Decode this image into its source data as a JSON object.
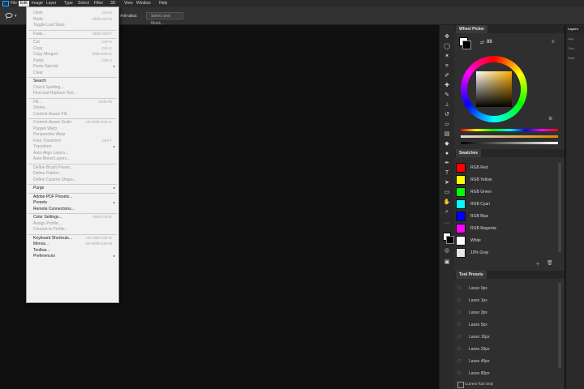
{
  "menubar": {
    "items": [
      "File",
      "Edit",
      "Image",
      "Layer",
      "Type",
      "Select",
      "Filter",
      "3D",
      "View",
      "Window",
      "Help"
    ],
    "active_index": 1
  },
  "options": {
    "anti_alias": "Anti-alias",
    "select_and_mask": "Select and Mask..."
  },
  "edit_menu": {
    "items": [
      {
        "label": "Undo",
        "shortcut": "Ctrl+Z",
        "enabled": false
      },
      {
        "label": "Redo",
        "shortcut": "Shift+Ctrl+Z",
        "enabled": false
      },
      {
        "label": "Toggle Last State",
        "shortcut": "",
        "enabled": false
      },
      {
        "sep": true
      },
      {
        "label": "Fade...",
        "shortcut": "Shift+Ctrl+F",
        "enabled": false
      },
      {
        "sep": true
      },
      {
        "label": "Cut",
        "shortcut": "Ctrl+X",
        "enabled": false
      },
      {
        "label": "Copy",
        "shortcut": "Ctrl+C",
        "enabled": false
      },
      {
        "label": "Copy Merged",
        "shortcut": "Shift+Ctrl+C",
        "enabled": false
      },
      {
        "label": "Paste",
        "shortcut": "Ctrl+V",
        "enabled": false
      },
      {
        "label": "Paste Special",
        "shortcut": "",
        "enabled": false,
        "submenu": true
      },
      {
        "label": "Clear",
        "shortcut": "",
        "enabled": false
      },
      {
        "sep": true
      },
      {
        "label": "Search",
        "shortcut": "",
        "enabled": true
      },
      {
        "label": "Check Spelling...",
        "shortcut": "",
        "enabled": false
      },
      {
        "label": "Find and Replace Text...",
        "shortcut": "",
        "enabled": false
      },
      {
        "sep": true
      },
      {
        "label": "Fill...",
        "shortcut": "Shift+F5",
        "enabled": false
      },
      {
        "label": "Stroke...",
        "shortcut": "",
        "enabled": false
      },
      {
        "label": "Content-Aware Fill...",
        "shortcut": "",
        "enabled": false
      },
      {
        "sep": true
      },
      {
        "label": "Content-Aware Scale",
        "shortcut": "Alt+Shift+Ctrl+C",
        "enabled": false
      },
      {
        "label": "Puppet Warp",
        "shortcut": "",
        "enabled": false
      },
      {
        "label": "Perspective Warp",
        "shortcut": "",
        "enabled": false
      },
      {
        "label": "Free Transform",
        "shortcut": "Ctrl+T",
        "enabled": false
      },
      {
        "label": "Transform",
        "shortcut": "",
        "enabled": false,
        "submenu": true
      },
      {
        "label": "Auto-Align Layers...",
        "shortcut": "",
        "enabled": false
      },
      {
        "label": "Auto-Blend Layers...",
        "shortcut": "",
        "enabled": false
      },
      {
        "sep": true
      },
      {
        "label": "Define Brush Preset...",
        "shortcut": "",
        "enabled": false
      },
      {
        "label": "Define Pattern...",
        "shortcut": "",
        "enabled": false
      },
      {
        "label": "Define Custom Shape...",
        "shortcut": "",
        "enabled": false
      },
      {
        "sep": true
      },
      {
        "label": "Purge",
        "shortcut": "",
        "enabled": true,
        "submenu": true
      },
      {
        "sep": true
      },
      {
        "label": "Adobe PDF Presets...",
        "shortcut": "",
        "enabled": true
      },
      {
        "label": "Presets",
        "shortcut": "",
        "enabled": true,
        "submenu": true
      },
      {
        "label": "Remote Connections...",
        "shortcut": "",
        "enabled": true
      },
      {
        "sep": true
      },
      {
        "label": "Color Settings...",
        "shortcut": "Shift+Ctrl+K",
        "enabled": true
      },
      {
        "label": "Assign Profile...",
        "shortcut": "",
        "enabled": false
      },
      {
        "label": "Convert to Profile...",
        "shortcut": "",
        "enabled": false
      },
      {
        "sep": true
      },
      {
        "label": "Keyboard Shortcuts...",
        "shortcut": "Alt+Shift+Ctrl+K",
        "enabled": true
      },
      {
        "label": "Menus...",
        "shortcut": "Alt+Shift+Ctrl+M",
        "enabled": true
      },
      {
        "label": "Toolbar...",
        "shortcut": "",
        "enabled": true
      },
      {
        "label": "Preferences",
        "shortcut": "",
        "enabled": true,
        "submenu": true
      }
    ]
  },
  "color_panel": {
    "tab": "Wheel Picker",
    "value": "88",
    "colors": {
      "accent": "#31a8ff"
    }
  },
  "swatches_panel": {
    "tab": "Swatches",
    "items": [
      {
        "label": "RGB Red",
        "color": "#ff0000"
      },
      {
        "label": "RGB Yellow",
        "color": "#ffff00"
      },
      {
        "label": "RGB Green",
        "color": "#00ff00"
      },
      {
        "label": "RGB Cyan",
        "color": "#00ffff"
      },
      {
        "label": "RGB Blue",
        "color": "#0000ff"
      },
      {
        "label": "RGB Magenta",
        "color": "#ff00ff"
      },
      {
        "label": "White",
        "color": "#ffffff"
      },
      {
        "label": "10% Gray",
        "color": "#e6e6e6"
      }
    ]
  },
  "tool_presets_panel": {
    "tab": "Tool Presets",
    "items": [
      "Lasso 0px",
      "Lasso 1px",
      "Lasso 3px",
      "Lasso 5px",
      "Lasso 10px",
      "Lasso 20px",
      "Lasso 40px",
      "Lasso 80px"
    ],
    "footer": "Current Tool Only"
  },
  "right_column": {
    "tab": "Layers",
    "items": [
      "Lay...",
      "Cha...",
      "Path..."
    ]
  },
  "tools": [
    "move-icon",
    "lasso-icon",
    "magic-wand-icon",
    "crop-icon",
    "eyedropper-icon",
    "healing-icon",
    "brush-icon",
    "stamp-icon",
    "history-brush-icon",
    "eraser-icon",
    "gradient-icon",
    "blur-icon",
    "dodge-icon",
    "pen-icon",
    "type-icon",
    "path-select-icon",
    "shape-icon",
    "hand-icon",
    "zoom-icon"
  ]
}
